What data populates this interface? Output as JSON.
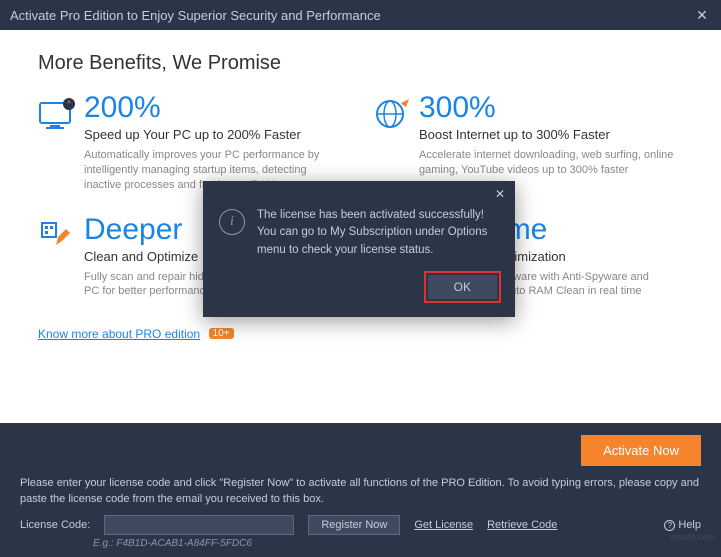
{
  "titlebar": {
    "text": "Activate Pro Edition to Enjoy Superior Security and Performance"
  },
  "heading": "More Benefits, We Promise",
  "cards": [
    {
      "big": "200%",
      "sub": "Speed up Your PC up to 200% Faster",
      "desc": "Automatically improves your PC performance by intelligently managing startup items, detecting inactive processes and freeing up RAM"
    },
    {
      "big": "300%",
      "sub": "Boost Internet up to 300% Faster",
      "desc": "Accelerate internet downloading, web surfing, online gaming, YouTube videos up to 300% faster"
    },
    {
      "big": "Deeper",
      "sub": "Clean and Optimize",
      "desc": "Fully scan and repair hidden registry issues on your PC for better performance"
    },
    {
      "big": "Real-time",
      "sub": "Protection & Optimization",
      "desc": "Protect against malware with Anti-Spyware and clean space with Auto RAM Clean in real time"
    }
  ],
  "know_more": {
    "text": "Know more about PRO edition",
    "badge": "10+"
  },
  "footer": {
    "activate": "Activate Now",
    "instr": "Please enter your license code and click \"Register Now\" to activate all functions of the PRO Edition. To avoid typing errors, please copy and paste the license code from the email you received to this box.",
    "code_label": "License Code:",
    "code_value": "",
    "register": "Register Now",
    "get_license": "Get License",
    "retrieve": "Retrieve Code",
    "help": "Help",
    "eg": "E.g.: F4B1D-ACAB1-A84FF-5FDC6"
  },
  "modal": {
    "line1": "The license has been activated successfully!",
    "line2": "You can go to My Subscription under Options menu to check your license status.",
    "ok": "OK"
  },
  "watermark": "wsxdn.com"
}
